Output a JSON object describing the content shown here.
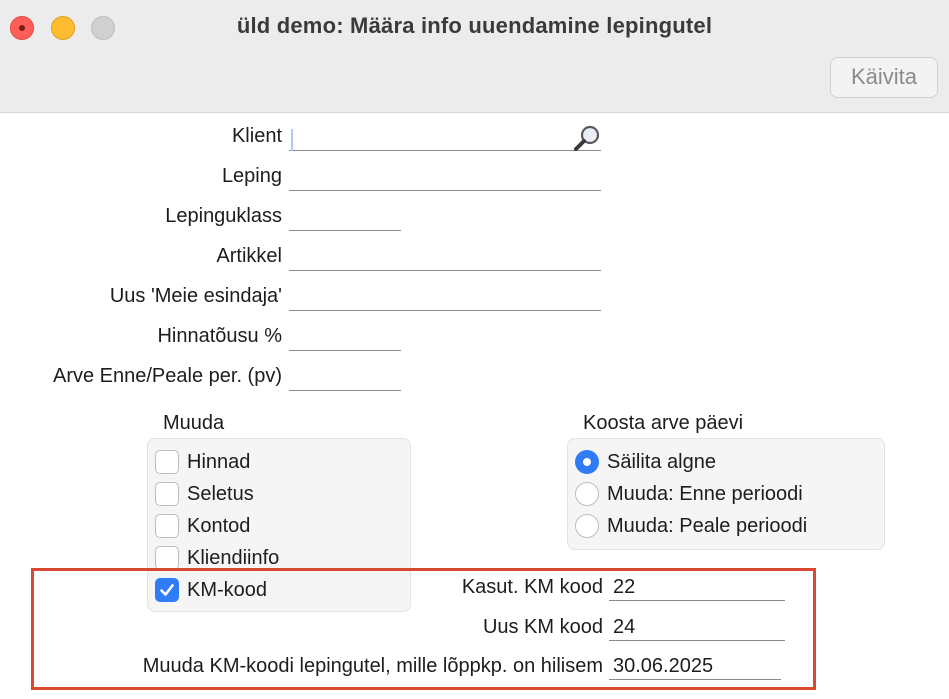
{
  "window": {
    "title": "üld demo: Määra info uuendamine lepingutel",
    "run_button": "Käivita"
  },
  "form": {
    "klient": {
      "label": "Klient",
      "value": ""
    },
    "leping": {
      "label": "Leping",
      "value": ""
    },
    "lepinguklass": {
      "label": "Lepinguklass",
      "value": ""
    },
    "artikkel": {
      "label": "Artikkel",
      "value": ""
    },
    "esindaja": {
      "label": "Uus 'Meie esindaja'",
      "value": ""
    },
    "hinnatousu": {
      "label": "Hinnatõusu %",
      "value": ""
    },
    "arve_enne_peale": {
      "label": "Arve Enne/Peale per. (pv)",
      "value": ""
    }
  },
  "muuda": {
    "title": "Muuda",
    "items": [
      {
        "label": "Hinnad",
        "checked": false
      },
      {
        "label": "Seletus",
        "checked": false
      },
      {
        "label": "Kontod",
        "checked": false
      },
      {
        "label": "Kliendiinfo",
        "checked": false
      },
      {
        "label": "KM-kood",
        "checked": true
      }
    ]
  },
  "koosta": {
    "title": "Koosta arve päevi",
    "options": [
      {
        "label": "Säilita algne",
        "selected": true
      },
      {
        "label": "Muuda: Enne perioodi",
        "selected": false
      },
      {
        "label": "Muuda: Peale perioodi",
        "selected": false
      }
    ]
  },
  "km": {
    "kasut": {
      "label": "Kasut. KM kood",
      "value": "22"
    },
    "uus": {
      "label": "Uus KM kood",
      "value": "24"
    },
    "kuupaev": {
      "label": "Muuda KM-koodi lepingutel, mille lõppkp. on hilisem",
      "value": "30.06.2025"
    }
  },
  "colors": {
    "accent": "#2f7cf6",
    "highlight": "#d84a30"
  },
  "icons": {
    "klient_search": "magnifier-icon"
  }
}
